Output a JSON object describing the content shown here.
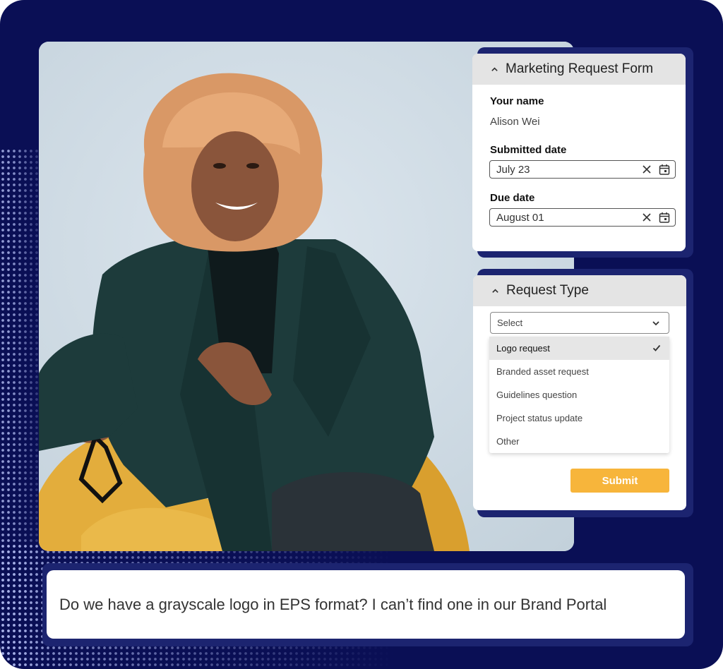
{
  "form_card": {
    "title": "Marketing Request Form",
    "name_label": "Your name",
    "name_value": "Alison Wei",
    "submitted_label": "Submitted date",
    "submitted_value": "July 23",
    "due_label": "Due date",
    "due_value": "August 01"
  },
  "type_card": {
    "title": "Request Type",
    "select_placeholder": "Select",
    "options": [
      {
        "label": "Logo request",
        "selected": true
      },
      {
        "label": "Branded asset request",
        "selected": false
      },
      {
        "label": "Guidelines question",
        "selected": false
      },
      {
        "label": "Project status update",
        "selected": false
      },
      {
        "label": "Other",
        "selected": false
      }
    ],
    "submit_label": "Submit"
  },
  "chat": {
    "message": "Do we have a grayscale logo in EPS format? I can’t find one in our Brand Portal"
  },
  "icons": {
    "collapse": "chevron-up-icon",
    "clear": "close-icon",
    "calendar": "calendar-icon",
    "dropdown": "chevron-down-icon",
    "selected": "checkmark-icon"
  },
  "colors": {
    "background": "#0a0f55",
    "accent": "#f7b53b",
    "card_header": "#e4e4e4"
  }
}
